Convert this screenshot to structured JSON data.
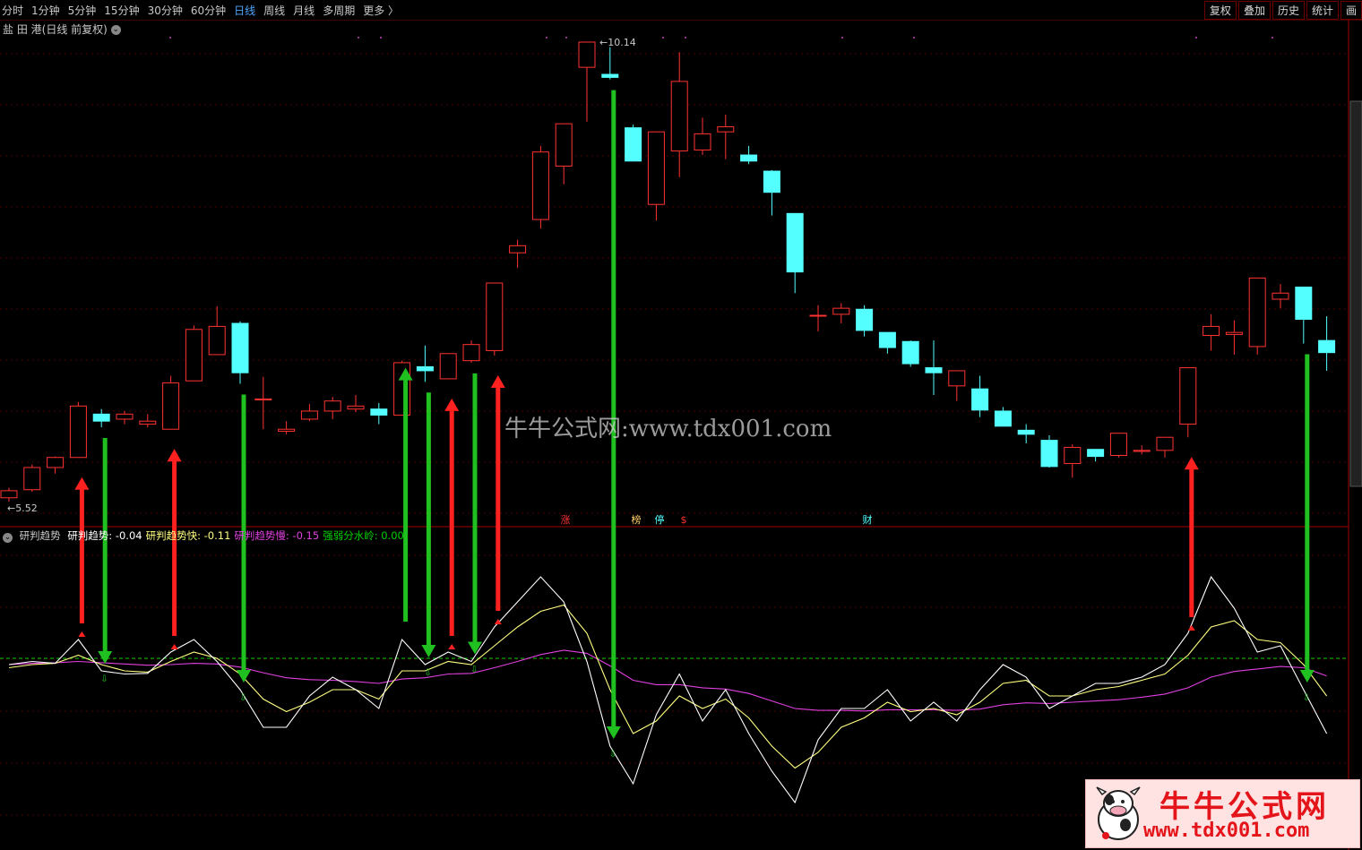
{
  "toolbar": {
    "periods": [
      "分时",
      "1分钟",
      "5分钟",
      "15分钟",
      "30分钟",
      "60分钟",
      "日线",
      "周线",
      "月线",
      "多周期",
      "更多 〉"
    ],
    "active_period": "日线",
    "right_buttons": [
      "复权",
      "叠加",
      "历史",
      "统计",
      "画"
    ]
  },
  "stock": {
    "name": "盐 田 港",
    "mode": "(日线 前复权)"
  },
  "price_labels": {
    "high": "10.14",
    "low": "5.52"
  },
  "event_markers": [
    "涨",
    "榜",
    "停",
    "$",
    "财"
  ],
  "indicator": {
    "name": "研判趋势",
    "items": [
      {
        "label": "研判趋势:",
        "value": "-0.04",
        "color": "#ffffff"
      },
      {
        "label": "研判趋势快:",
        "value": "-0.11",
        "color": "#ffff80"
      },
      {
        "label": "研判趋势慢:",
        "value": "-0.15",
        "color": "#e040e0"
      },
      {
        "label": "强弱分水岭:",
        "value": "0.00",
        "color": "#00d000"
      }
    ]
  },
  "watermark": "牛牛公式网:www.tdx001.com",
  "logo": {
    "name": "牛牛公式网",
    "url": "www.tdx001.com"
  },
  "colors": {
    "up": "#ff3232",
    "down": "#54ffff",
    "buy_arrow": "#ff2020",
    "sell_arrow": "#20c020",
    "main_line": "#ffffff",
    "fast_line": "#ffff80",
    "slow_line": "#e040e0",
    "divider": "#00d000"
  },
  "candles": [
    [
      5.62,
      5.72,
      5.58,
      5.69
    ],
    [
      5.7,
      5.95,
      5.68,
      5.92
    ],
    [
      5.92,
      6.03,
      5.86,
      6.02
    ],
    [
      6.02,
      6.57,
      6.02,
      6.53
    ],
    [
      6.45,
      6.5,
      6.32,
      6.38
    ],
    [
      6.4,
      6.48,
      6.35,
      6.45
    ],
    [
      6.35,
      6.45,
      6.32,
      6.38
    ],
    [
      6.3,
      6.83,
      6.3,
      6.76
    ],
    [
      6.78,
      7.33,
      6.78,
      7.29
    ],
    [
      7.04,
      7.52,
      7.04,
      7.32
    ],
    [
      7.35,
      7.37,
      6.75,
      6.86
    ],
    [
      6.6,
      6.82,
      6.3,
      6.6
    ],
    [
      6.28,
      6.38,
      6.25,
      6.3
    ],
    [
      6.4,
      6.55,
      6.38,
      6.48
    ],
    [
      6.48,
      6.62,
      6.4,
      6.58
    ],
    [
      6.5,
      6.64,
      6.47,
      6.53
    ],
    [
      6.5,
      6.56,
      6.35,
      6.44
    ],
    [
      6.44,
      6.98,
      6.44,
      6.96
    ],
    [
      6.92,
      7.13,
      6.77,
      6.88
    ],
    [
      6.8,
      7.05,
      6.8,
      7.05
    ],
    [
      6.98,
      7.18,
      6.96,
      7.14
    ],
    [
      7.08,
      7.75,
      7.03,
      7.75
    ],
    [
      8.05,
      8.18,
      7.9,
      8.12
    ],
    [
      8.38,
      9.11,
      8.29,
      9.05
    ],
    [
      8.91,
      9.32,
      8.73,
      9.33
    ],
    [
      9.89,
      10.14,
      9.35,
      10.14
    ],
    [
      9.82,
      10.09,
      9.77,
      9.79
    ],
    [
      9.29,
      9.32,
      9.03,
      8.96
    ],
    [
      8.53,
      8.78,
      8.37,
      9.25
    ],
    [
      9.06,
      10.04,
      8.8,
      9.75
    ],
    [
      9.07,
      9.39,
      9.02,
      9.23
    ],
    [
      9.25,
      9.42,
      8.98,
      9.3
    ],
    [
      9.02,
      9.11,
      8.93,
      8.96
    ],
    [
      8.86,
      8.87,
      8.42,
      8.65
    ],
    [
      8.44,
      8.43,
      7.65,
      7.86
    ],
    [
      7.43,
      7.53,
      7.27,
      7.43
    ],
    [
      7.44,
      7.55,
      7.35,
      7.5
    ],
    [
      7.49,
      7.53,
      7.22,
      7.28
    ],
    [
      7.26,
      7.2,
      7.05,
      7.11
    ],
    [
      7.17,
      7.18,
      6.92,
      6.95
    ],
    [
      6.91,
      7.18,
      6.64,
      6.86
    ],
    [
      6.73,
      6.82,
      6.58,
      6.88
    ],
    [
      6.7,
      6.83,
      6.42,
      6.49
    ],
    [
      6.48,
      6.52,
      6.43,
      6.33
    ],
    [
      6.29,
      6.35,
      6.16,
      6.25
    ],
    [
      6.19,
      6.24,
      5.92,
      5.93
    ],
    [
      5.96,
      6.15,
      5.82,
      6.12
    ],
    [
      6.1,
      6.08,
      5.98,
      6.03
    ],
    [
      6.04,
      6.25,
      6.02,
      6.26
    ],
    [
      6.08,
      6.14,
      6.05,
      6.09
    ],
    [
      6.09,
      6.22,
      6.02,
      6.22
    ],
    [
      6.35,
      6.91,
      6.22,
      6.91
    ],
    [
      7.23,
      7.44,
      7.08,
      7.32
    ],
    [
      7.24,
      7.38,
      7.04,
      7.26
    ],
    [
      7.12,
      7.78,
      7.04,
      7.8
    ],
    [
      7.59,
      7.74,
      7.5,
      7.65
    ],
    [
      7.71,
      7.63,
      7.15,
      7.39
    ],
    [
      7.18,
      7.42,
      6.88,
      7.06
    ]
  ],
  "indicator_series": {
    "main": [
      -0.1,
      -0.05,
      -0.08,
      0.3,
      -0.2,
      -0.25,
      -0.24,
      0.1,
      0.3,
      -0.05,
      -0.5,
      -1.1,
      -1.1,
      -0.6,
      -0.3,
      -0.5,
      -0.8,
      0.3,
      -0.1,
      0.1,
      -0.05,
      0.5,
      0.9,
      1.3,
      0.9,
      -0.05,
      -1.4,
      -2.0,
      -0.9,
      -0.25,
      -1.0,
      -0.5,
      -1.2,
      -1.8,
      -2.3,
      -1.3,
      -0.8,
      -0.8,
      -0.5,
      -1.0,
      -0.7,
      -1.0,
      -0.5,
      -0.1,
      -0.3,
      -0.8,
      -0.6,
      -0.4,
      -0.4,
      -0.3,
      -0.1,
      0.4,
      1.3,
      0.8,
      0.1,
      0.2,
      -0.5,
      -1.2
    ],
    "fast": [
      -0.15,
      -0.1,
      -0.08,
      0.05,
      -0.1,
      -0.2,
      -0.22,
      -0.05,
      0.1,
      0.0,
      -0.25,
      -0.65,
      -0.85,
      -0.7,
      -0.5,
      -0.5,
      -0.65,
      -0.2,
      -0.2,
      -0.05,
      -0.1,
      0.2,
      0.5,
      0.75,
      0.85,
      0.4,
      -0.5,
      -1.2,
      -1.0,
      -0.6,
      -0.8,
      -0.65,
      -0.95,
      -1.4,
      -1.75,
      -1.5,
      -1.1,
      -0.95,
      -0.7,
      -0.85,
      -0.8,
      -0.9,
      -0.7,
      -0.4,
      -0.35,
      -0.6,
      -0.6,
      -0.5,
      -0.45,
      -0.35,
      -0.25,
      0.05,
      0.5,
      0.6,
      0.3,
      0.25,
      -0.1,
      -0.6
    ],
    "slow": [
      -0.1,
      -0.08,
      -0.07,
      -0.05,
      -0.07,
      -0.09,
      -0.11,
      -0.1,
      -0.08,
      -0.09,
      -0.14,
      -0.23,
      -0.31,
      -0.34,
      -0.35,
      -0.37,
      -0.4,
      -0.33,
      -0.31,
      -0.25,
      -0.24,
      -0.15,
      -0.05,
      0.06,
      0.13,
      0.08,
      -0.12,
      -0.35,
      -0.42,
      -0.42,
      -0.47,
      -0.49,
      -0.56,
      -0.68,
      -0.8,
      -0.83,
      -0.83,
      -0.84,
      -0.82,
      -0.82,
      -0.82,
      -0.83,
      -0.81,
      -0.74,
      -0.71,
      -0.72,
      -0.7,
      -0.68,
      -0.66,
      -0.62,
      -0.57,
      -0.47,
      -0.3,
      -0.21,
      -0.17,
      -0.13,
      -0.15,
      -0.28
    ]
  },
  "signals": [
    {
      "i": 3,
      "type": "buy"
    },
    {
      "i": 4,
      "type": "sell"
    },
    {
      "i": 7,
      "type": "buy"
    },
    {
      "i": 10,
      "type": "sell"
    },
    {
      "i": 17,
      "type": "sell_up"
    },
    {
      "i": 18,
      "type": "sell"
    },
    {
      "i": 19,
      "type": "buy"
    },
    {
      "i": 20,
      "type": "sell"
    },
    {
      "i": 21,
      "type": "buy"
    },
    {
      "i": 26,
      "type": "sell"
    },
    {
      "i": 51,
      "type": "buy"
    },
    {
      "i": 56,
      "type": "sell"
    }
  ]
}
